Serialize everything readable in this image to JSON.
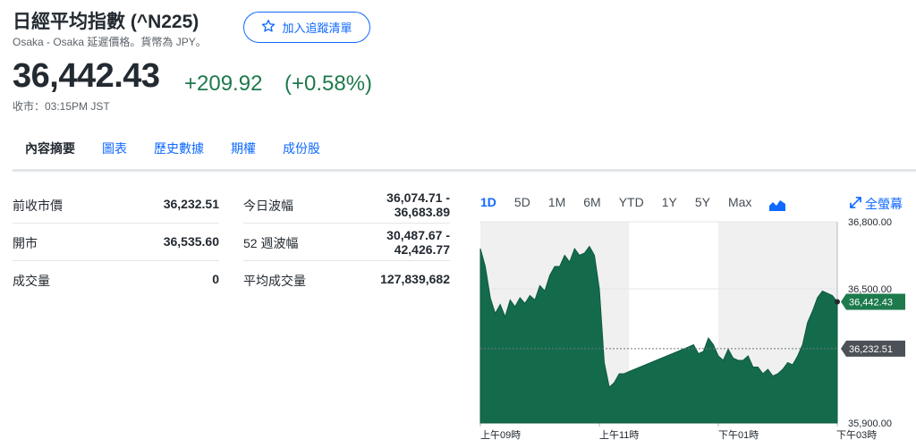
{
  "header": {
    "title": "日經平均指數 (^N225)",
    "subtitle": "Osaka - Osaka 延遲價格。貨幣為 JPY。",
    "watchlist_label": "加入追蹤清單"
  },
  "quote": {
    "price": "36,442.43",
    "change": "+209.92",
    "change_percent": "(+0.58%)",
    "close_time": "收市：03:15PM JST",
    "up_color": "#1d7a4c"
  },
  "tabs": [
    {
      "label": "內容摘要",
      "active": true
    },
    {
      "label": "圖表",
      "active": false
    },
    {
      "label": "歷史數據",
      "active": false
    },
    {
      "label": "期權",
      "active": false
    },
    {
      "label": "成份股",
      "active": false
    }
  ],
  "stats_left": [
    {
      "label": "前收市價",
      "value": "36,232.51"
    },
    {
      "label": "開市",
      "value": "36,535.60"
    },
    {
      "label": "成交量",
      "value": "0"
    }
  ],
  "stats_right": [
    {
      "label": "今日波幅",
      "value_line1": "36,074.71 -",
      "value_line2": "36,683.89"
    },
    {
      "label": "52 週波幅",
      "value_line1": "30,487.67 -",
      "value_line2": "42,426.77"
    },
    {
      "label": "平均成交量",
      "value": "127,839,682"
    }
  ],
  "chart_controls": {
    "ranges": [
      "1D",
      "5D",
      "1M",
      "6M",
      "YTD",
      "1Y",
      "5Y",
      "Max"
    ],
    "active_range": "1D",
    "chart_type_icon": "area-chart-icon",
    "fullscreen_label": "全螢幕"
  },
  "chart_data": {
    "type": "area",
    "x": [
      "09:00",
      "09:05",
      "09:10",
      "09:15",
      "09:20",
      "09:25",
      "09:30",
      "09:35",
      "09:40",
      "09:45",
      "09:50",
      "09:55",
      "10:00",
      "10:05",
      "10:10",
      "10:15",
      "10:20",
      "10:25",
      "10:30",
      "10:35",
      "10:40",
      "10:45",
      "10:50",
      "10:55",
      "11:00",
      "11:05",
      "11:10",
      "11:15",
      "11:20",
      "11:25",
      "11:30",
      "12:30",
      "12:35",
      "12:40",
      "12:45",
      "12:50",
      "12:55",
      "13:00",
      "13:05",
      "13:10",
      "13:15",
      "13:20",
      "13:25",
      "13:30",
      "13:35",
      "13:40",
      "13:45",
      "13:50",
      "13:55",
      "14:00",
      "14:05",
      "14:10",
      "14:15",
      "14:20",
      "14:25",
      "14:30",
      "14:35",
      "14:40",
      "14:45",
      "14:50",
      "14:55",
      "15:00"
    ],
    "series": [
      {
        "values": [
          36680,
          36600,
          36460,
          36390,
          36430,
          36375,
          36450,
          36420,
          36460,
          36435,
          36470,
          36450,
          36515,
          36490,
          36560,
          36600,
          36600,
          36650,
          36620,
          36680,
          36650,
          36660,
          36690,
          36650,
          36500,
          36170,
          36060,
          36080,
          36120,
          36120,
          36130,
          36240,
          36250,
          36210,
          36220,
          36280,
          36250,
          36200,
          36180,
          36230,
          36190,
          36180,
          36180,
          36200,
          36150,
          36150,
          36120,
          36140,
          36110,
          36120,
          36140,
          36170,
          36160,
          36200,
          36250,
          36350,
          36400,
          36460,
          36490,
          36480,
          36470,
          36442
        ]
      }
    ],
    "y_ticks": [
      "36,800.00",
      "36,500.00",
      "35,900.00"
    ],
    "x_ticks": [
      "上午09時",
      "上午11時",
      "下午01時",
      "下午03時"
    ],
    "ylim": [
      35900,
      36800
    ],
    "previous_close": 36232.51,
    "previous_close_label": "36,232.51",
    "last_price_label": "36,442.43",
    "area_color": "#146b4c",
    "shaded_sessions": [
      "09:00-11:30",
      "13:00-15:00"
    ]
  }
}
